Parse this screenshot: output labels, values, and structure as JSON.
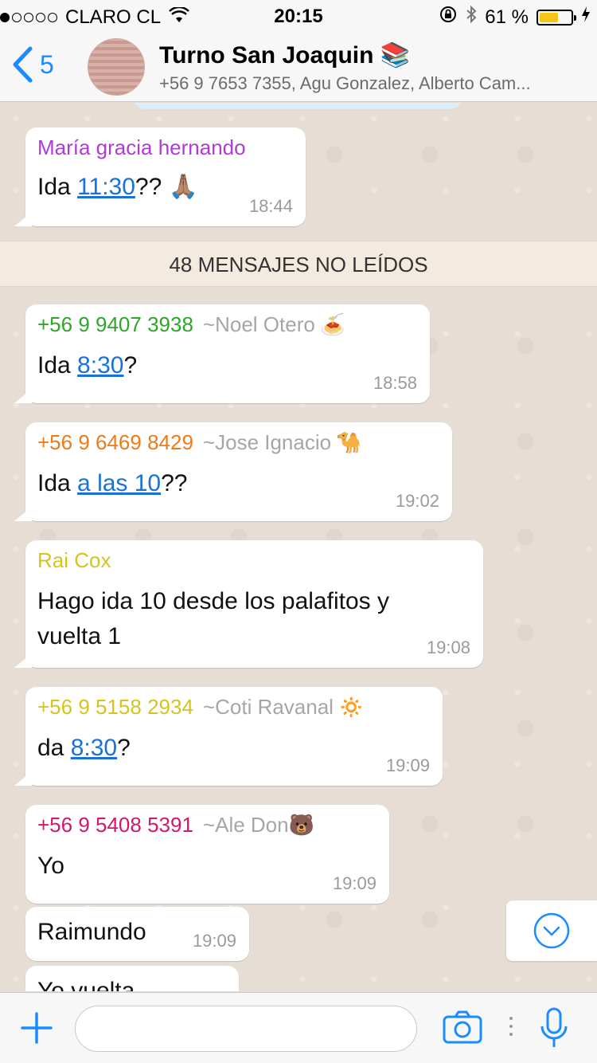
{
  "status_bar": {
    "carrier": "CLARO CL",
    "time": "20:15",
    "battery": "61 %",
    "battery_level": 0.61,
    "icons": [
      "wifi-icon",
      "orientation-lock-icon",
      "bluetooth-icon",
      "battery-icon",
      "charging-bolt-icon"
    ]
  },
  "header": {
    "back_count": "5",
    "title": "Turno San Joaquin 📚",
    "subtitle": "+56 9 7653 7355, Agu Gonzalez, Alberto Cam..."
  },
  "unread_banner": "48 MENSAJES NO LEÍDOS",
  "messages": [
    {
      "sender": "María gracia hernando",
      "sender_color": "#b03ad6",
      "alias": "",
      "emoji": "",
      "text_before": "Ida ",
      "link": "11:30",
      "text_after": "?? 🙏🏽",
      "time": "18:44"
    },
    {
      "sender": "+56 9 9407 3938",
      "sender_color": "#2ea52b",
      "alias": "~Noel Otero",
      "emoji": "🍝",
      "text_before": "Ida ",
      "link": "8:30",
      "text_after": "?",
      "time": "18:58"
    },
    {
      "sender": "+56 9 6469 8429",
      "sender_color": "#ef7b18",
      "alias": "~Jose Ignacio",
      "emoji": "🐪",
      "text_before": "Ida ",
      "link": "a las 10",
      "text_after": "??",
      "time": "19:02"
    },
    {
      "sender": "Rai Cox",
      "sender_color": "#d4c51c",
      "alias": "",
      "emoji": "",
      "text": "Hago ida 10 desde los palafitos y vuelta 1",
      "time": "19:08"
    },
    {
      "sender": "+56 9 5158 2934",
      "sender_color": "#d4c51c",
      "alias": "~Coti Ravanal",
      "emoji": "🔅",
      "text_before": "da ",
      "link": "8:30",
      "text_after": "?",
      "time": "19:09"
    },
    {
      "sender": "+56 9 5408 5391",
      "sender_color": "#d4176b",
      "alias": "~Ale Don",
      "emoji": "🐻",
      "text": "Yo",
      "time": "19:09"
    },
    {
      "text": "Raimundo",
      "time": "19:09"
    },
    {
      "text": "Yo vuelta"
    }
  ],
  "input": {
    "placeholder": ""
  }
}
